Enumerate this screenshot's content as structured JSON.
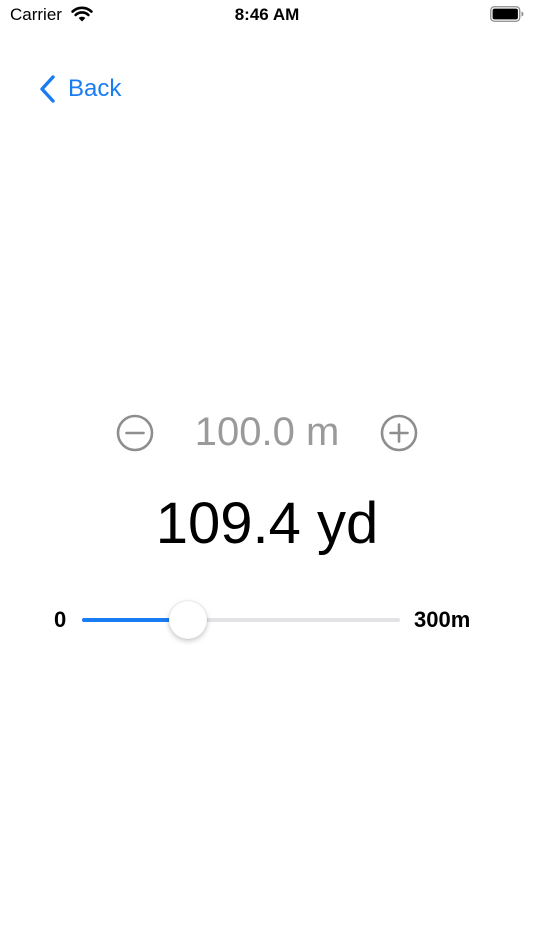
{
  "status_bar": {
    "carrier": "Carrier",
    "time": "8:46 AM",
    "icons": [
      "wifi-icon",
      "battery-icon"
    ]
  },
  "nav": {
    "back_label": "Back",
    "back_icon": "chevron-left-icon"
  },
  "converter": {
    "meters_text": "100.0 m",
    "yards_text": "109.4 yd",
    "minus_icon": "minus-circle-icon",
    "plus_icon": "plus-circle-icon"
  },
  "slider": {
    "min_label": "0",
    "max_label": "300m",
    "min": 0,
    "max": 300,
    "value": 100
  },
  "colors": {
    "accent": "#1a7cf3",
    "secondary_text": "#9a9a9a",
    "track": "#e3e3e6"
  }
}
